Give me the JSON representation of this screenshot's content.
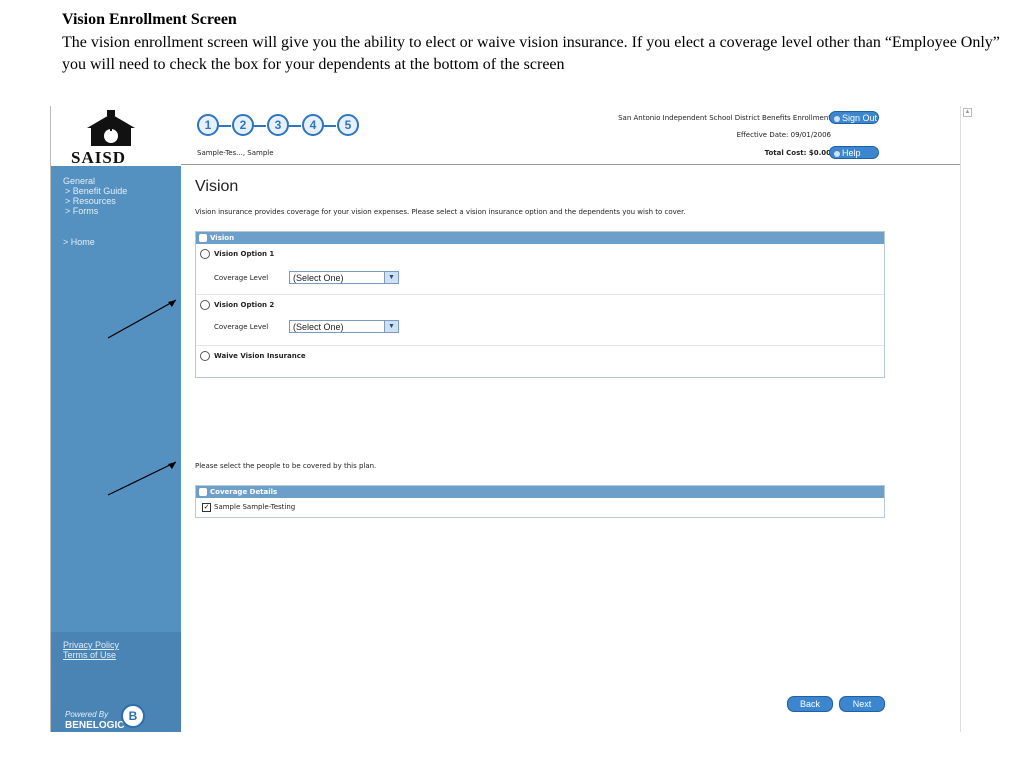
{
  "doc": {
    "title": "Vision Enrollment Screen",
    "description": "The vision enrollment screen will give you the ability to elect or waive vision insurance. If you elect a coverage level other than “Employee Only” you will need to check the box for your dependents at the bottom of the screen"
  },
  "sidebar": {
    "logo_text": "SAISD",
    "menu_heading": "General",
    "menu_items": [
      "> Benefit Guide",
      "> Resources",
      "> Forms"
    ],
    "home": "> Home",
    "privacy": "Privacy Policy",
    "terms": "Terms of Use",
    "powered_by": "Powered By",
    "benelogic": "BENELOGIC",
    "benelogic_icon": "B"
  },
  "header": {
    "steps": [
      "1",
      "2",
      "3",
      "4",
      "5"
    ],
    "district": "San Antonio Independent School District Benefits Enrollment",
    "effective_date": "Effective Date: 09/01/2006",
    "user": "Sample-Tes..., Sample",
    "total_cost": "Total Cost: $0.00",
    "sign_out": "Sign Out",
    "help": "Help"
  },
  "main": {
    "title": "Vision",
    "intro": "Vision insurance provides coverage for your vision expenses. Please select a vision insurance option and the dependents you wish to cover.",
    "vision_panel": {
      "header": "Vision",
      "option1": "Vision Option 1",
      "option2": "Vision Option 2",
      "waive": "Waive Vision Insurance",
      "coverage_label": "Coverage Level",
      "select_value": "(Select One)"
    },
    "people_text": "Please select the people to be covered by this plan.",
    "coverage_panel": {
      "header": "Coverage Details",
      "person": "Sample Sample-Testing",
      "checked": true
    },
    "back": "Back",
    "next": "Next"
  },
  "colors": {
    "sidebar": "#5591c0",
    "panel_header": "#6d9fcb",
    "step": "#2f76c2"
  }
}
